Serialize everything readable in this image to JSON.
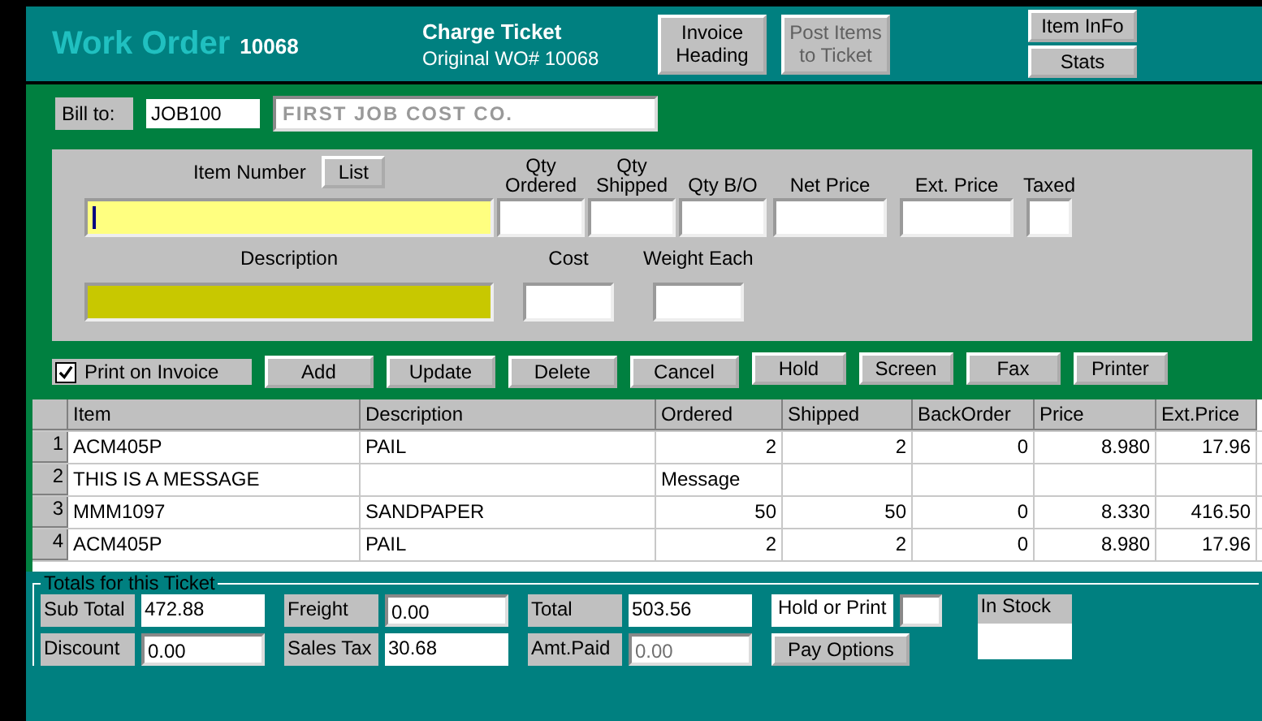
{
  "header": {
    "title": "Work Order",
    "number": "10068",
    "ticket_title": "Charge Ticket",
    "ticket_sub": "Original WO# 10068",
    "buttons": [
      {
        "label": "Invoice Heading",
        "disabled": false
      },
      {
        "label": "Post Items to Ticket",
        "disabled": true
      }
    ],
    "side_buttons": [
      "Item InFo",
      "Stats"
    ]
  },
  "bill_to": {
    "label": "Bill to:",
    "code": "JOB100",
    "name": "FIRST JOB COST CO.",
    "name_disabled": true
  },
  "entry": {
    "item_label": "Item Number",
    "list_button": "List",
    "qty_columns": [
      {
        "label": "Qty Ordered"
      },
      {
        "label": "Qty Shipped"
      },
      {
        "label": "Qty B/O"
      },
      {
        "label": "Net Price"
      },
      {
        "label": "Ext. Price"
      },
      {
        "label": "Taxed"
      }
    ],
    "description_label": "Description",
    "cost_label": "Cost",
    "weight_label": "Weight Each"
  },
  "actions": {
    "print_on_invoice": {
      "label": "Print on Invoice",
      "checked": true
    },
    "buttons": [
      "Add",
      "Update",
      "Delete",
      "Cancel",
      "Hold",
      "Screen",
      "Fax",
      "Printer"
    ]
  },
  "table": {
    "columns": [
      "Item",
      "Description",
      "Ordered",
      "Shipped",
      "BackOrder",
      "Price",
      "Ext.Price"
    ],
    "rows": [
      {
        "num": "1",
        "cells": [
          "ACM405P",
          "PAIL",
          "2",
          "2",
          "0",
          "8.980",
          "17.96"
        ]
      },
      {
        "num": "2",
        "cells": [
          "THIS IS A MESSAGE",
          "",
          "Message",
          "",
          "",
          "",
          ""
        ]
      },
      {
        "num": "3",
        "cells": [
          "MMM1097",
          "SANDPAPER",
          "50",
          "50",
          "0",
          "8.330",
          "416.50"
        ]
      },
      {
        "num": "4",
        "cells": [
          "ACM405P",
          "PAIL",
          "2",
          "2",
          "0",
          "8.980",
          "17.96"
        ]
      }
    ]
  },
  "totals": {
    "title": "Totals for this Ticket",
    "rows": [
      [
        {
          "label": "Sub Total",
          "value": "472.88",
          "kind": "readout"
        },
        {
          "label": "Freight",
          "value": "0.00",
          "kind": "input"
        },
        {
          "label": "Total",
          "value": "503.56",
          "kind": "readout"
        }
      ],
      [
        {
          "label": "Discount",
          "value": "0.00",
          "kind": "input"
        },
        {
          "label": "Sales Tax",
          "value": "30.68",
          "kind": "readout"
        },
        {
          "label": "Amt.Paid",
          "value": "0.00",
          "kind": "disabled"
        }
      ]
    ],
    "hold_label": "Hold or Print",
    "pay_button": "Pay Options",
    "stock_label": "In Stock"
  }
}
